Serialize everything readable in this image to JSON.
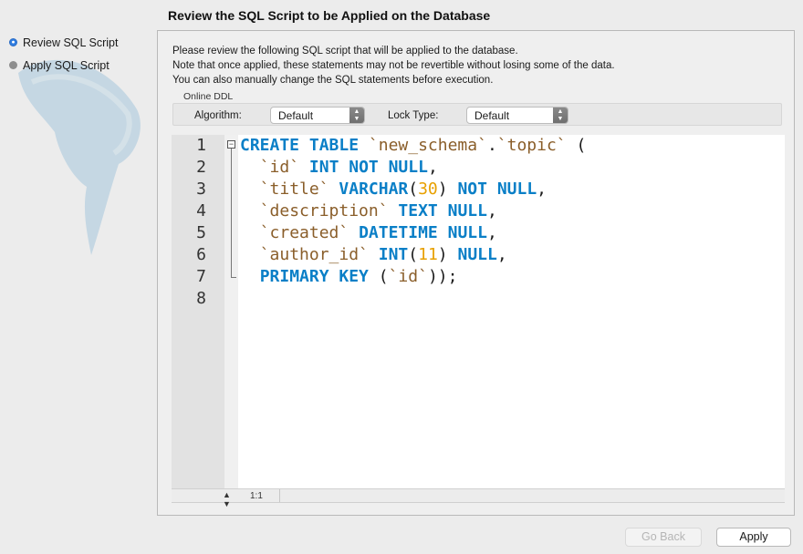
{
  "wizard": {
    "title": "Review the SQL Script to be Applied on the Database",
    "steps": [
      {
        "label": "Review SQL Script",
        "state": "active"
      },
      {
        "label": "Apply SQL Script",
        "state": "pending"
      }
    ]
  },
  "intro": [
    "Please review the following SQL script that will be applied to the database.",
    "Note that once applied, these statements may not be revertible without losing some of the data.",
    "You can also manually change the SQL statements before execution."
  ],
  "online_ddl": {
    "title": "Online DDL",
    "algorithm_label": "Algorithm:",
    "algorithm_value": "Default",
    "lock_type_label": "Lock Type:",
    "lock_type_value": "Default"
  },
  "editor": {
    "line_numbers": [
      "1",
      "2",
      "3",
      "4",
      "5",
      "6",
      "7",
      "8"
    ],
    "lines": [
      [
        {
          "t": "CREATE TABLE ",
          "c": "kw"
        },
        {
          "t": "`new_schema`",
          "c": "id"
        },
        {
          "t": ".",
          "c": "plain"
        },
        {
          "t": "`topic`",
          "c": "id"
        },
        {
          "t": " (",
          "c": "plain"
        }
      ],
      [
        {
          "t": "  ",
          "c": "plain"
        },
        {
          "t": "`id`",
          "c": "id"
        },
        {
          "t": " ",
          "c": "plain"
        },
        {
          "t": "INT NOT NULL",
          "c": "kw"
        },
        {
          "t": ",",
          "c": "plain"
        }
      ],
      [
        {
          "t": "  ",
          "c": "plain"
        },
        {
          "t": "`title`",
          "c": "id"
        },
        {
          "t": " ",
          "c": "plain"
        },
        {
          "t": "VARCHAR",
          "c": "kw"
        },
        {
          "t": "(",
          "c": "plain"
        },
        {
          "t": "30",
          "c": "num"
        },
        {
          "t": ") ",
          "c": "plain"
        },
        {
          "t": "NOT NULL",
          "c": "kw"
        },
        {
          "t": ",",
          "c": "plain"
        }
      ],
      [
        {
          "t": "  ",
          "c": "plain"
        },
        {
          "t": "`description`",
          "c": "id"
        },
        {
          "t": " ",
          "c": "plain"
        },
        {
          "t": "TEXT NULL",
          "c": "kw"
        },
        {
          "t": ",",
          "c": "plain"
        }
      ],
      [
        {
          "t": "  ",
          "c": "plain"
        },
        {
          "t": "`created`",
          "c": "id"
        },
        {
          "t": " ",
          "c": "plain"
        },
        {
          "t": "DATETIME NULL",
          "c": "kw"
        },
        {
          "t": ",",
          "c": "plain"
        }
      ],
      [
        {
          "t": "  ",
          "c": "plain"
        },
        {
          "t": "`author_id`",
          "c": "id"
        },
        {
          "t": " ",
          "c": "plain"
        },
        {
          "t": "INT",
          "c": "kw"
        },
        {
          "t": "(",
          "c": "plain"
        },
        {
          "t": "11",
          "c": "num"
        },
        {
          "t": ") ",
          "c": "plain"
        },
        {
          "t": "NULL",
          "c": "kw"
        },
        {
          "t": ",",
          "c": "plain"
        }
      ],
      [
        {
          "t": "  ",
          "c": "plain"
        },
        {
          "t": "PRIMARY KEY",
          "c": "kw"
        },
        {
          "t": " (",
          "c": "plain"
        },
        {
          "t": "`id`",
          "c": "id"
        },
        {
          "t": "));",
          "c": "plain"
        }
      ],
      []
    ],
    "cursor_position": "1:1"
  },
  "buttons": {
    "back": "Go Back",
    "apply": "Apply"
  },
  "colors": {
    "keyword": "#0a7fc7",
    "identifier": "#8a5e2a",
    "number": "#e8a000",
    "active_step": "#2f7de1"
  },
  "icons": [
    "dolphin-watermark-icon",
    "step-active-icon",
    "step-pending-icon",
    "fold-collapse-icon",
    "stepper-icon",
    "dropdown-arrow-icon"
  ]
}
